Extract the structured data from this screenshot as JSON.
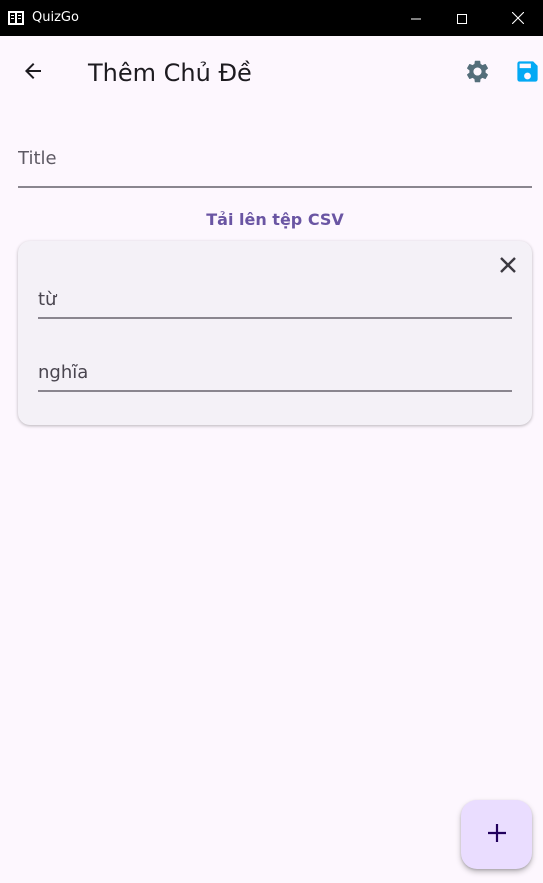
{
  "window": {
    "title": "QuizGo",
    "icons": {
      "app": "quizgo-app-icon",
      "minimize": "minimize-icon",
      "maximize": "maximize-icon",
      "close": "close-icon"
    }
  },
  "appbar": {
    "title": "Thêm Chủ Đề",
    "icons": {
      "back": "arrow-back-icon",
      "settings": "gear-icon",
      "save": "floppy-disk-icon"
    }
  },
  "form": {
    "title_placeholder": "Title",
    "title_value": "",
    "upload_label": "Tải lên tệp CSV"
  },
  "card": {
    "term_placeholder": "từ",
    "term_value": "",
    "meaning_placeholder": "nghĩa",
    "meaning_value": "",
    "close_icon": "close-icon"
  },
  "fab": {
    "icon": "plus-icon"
  },
  "colors": {
    "background": "#fdf7fe",
    "accent": "#6a55a3",
    "settings_icon": "#546e7a",
    "save_icon": "#03a9f4",
    "card": "#f4f1f7",
    "fab": "#eaddff"
  }
}
